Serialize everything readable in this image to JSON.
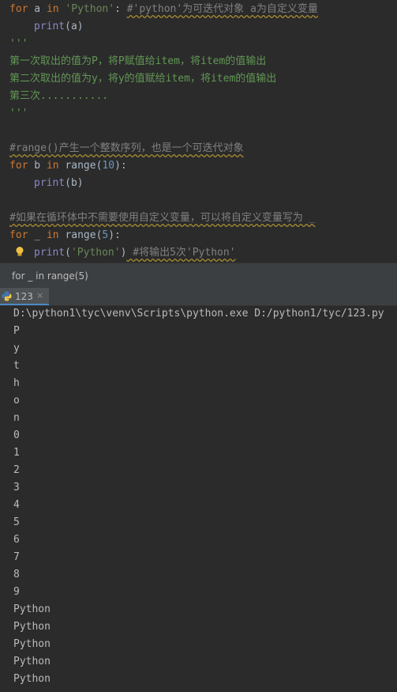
{
  "editor": {
    "line1": {
      "kw_for": "for",
      "var": " a ",
      "kw_in": "in",
      "sp": " ",
      "str": "'Python'",
      "colon": ": ",
      "comment": "#'python'为可迭代对象 a为自定义变量"
    },
    "line2": {
      "fn": "print",
      "args": "(a)"
    },
    "line3": "'''",
    "line4": "第一次取出的值为P，将P赋值给item，将item的值输出",
    "line5": "第二次取出的值为y，将y的值赋给item，将item的值输出",
    "line6": "第三次...........",
    "line7": "'''",
    "line8": "#range()产生一个整数序列，也是一个可迭代对象",
    "line9": {
      "kw_for": "for",
      "var": " b ",
      "kw_in": "in",
      "rest": " range(",
      "num": "10",
      "end": "):"
    },
    "line10": {
      "fn": "print",
      "args": "(b)"
    },
    "line11": "#如果在循环体中不需要使用自定义变量，可以将自定义变量写为 _",
    "line12": {
      "kw_for": "for",
      "var": " _ ",
      "kw_in": "in",
      "rest": " range(",
      "num": "5",
      "end": "):"
    },
    "line13": {
      "fn": "print",
      "open": "(",
      "str": "'Python'",
      "close": ")",
      "comment": " #将输出5次'Python'"
    }
  },
  "breadcrumb": "for _ in range(5)",
  "run_tab": {
    "label": "123",
    "close": "×"
  },
  "console": {
    "lines": [
      "D:\\python1\\tyc\\venv\\Scripts\\python.exe D:/python1/tyc/123.py",
      "P",
      "y",
      "t",
      "h",
      "o",
      "n",
      "0",
      "1",
      "2",
      "3",
      "4",
      "5",
      "6",
      "7",
      "8",
      "9",
      "Python",
      "Python",
      "Python",
      "Python",
      "Python"
    ]
  },
  "colors": {
    "keyword": "#cc7832",
    "string": "#6a8759",
    "comment": "#808080",
    "docstring": "#629755",
    "number": "#6897bb",
    "background": "#2b2b2b"
  },
  "icons": [
    "lightbulb-icon",
    "python-icon"
  ]
}
